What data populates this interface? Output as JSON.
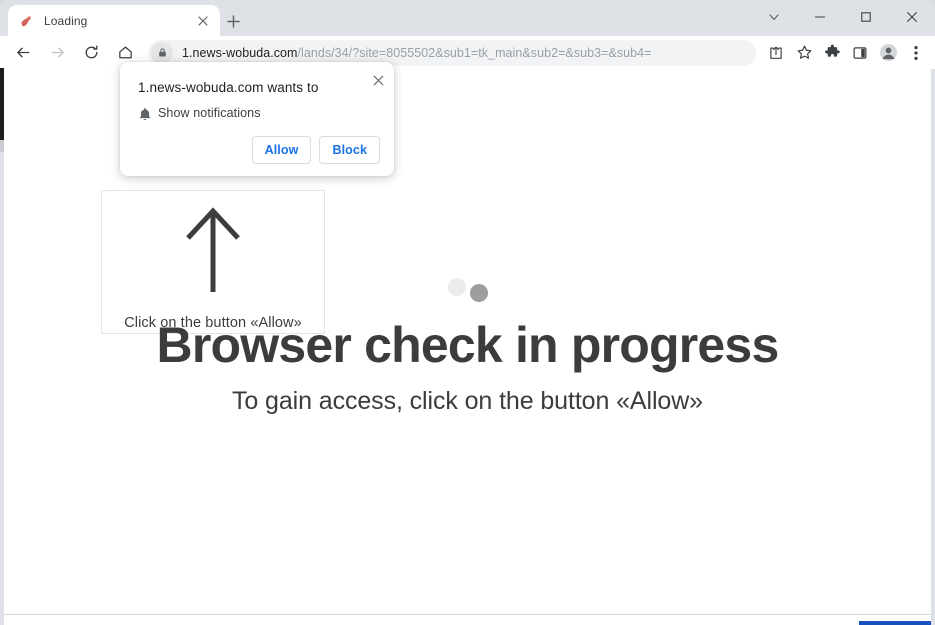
{
  "window": {
    "controls": {
      "tab_search": "tab-search-chevron",
      "minimize": "minimize",
      "maximize": "maximize",
      "close": "close"
    }
  },
  "tabstrip": {
    "tabs": [
      {
        "title": "Loading",
        "favicon": "site-favicon",
        "close_label": "Close tab"
      }
    ],
    "new_tab_label": "New tab"
  },
  "toolbar": {
    "back_label": "Back",
    "forward_label": "Forward",
    "reload_label": "Reload",
    "home_label": "Home",
    "omnibox": {
      "lock_icon": "lock-icon",
      "url_host": "1.news-wobuda.com",
      "url_path": "/lands/34/?site=8055502&sub1=tk_main&sub2=&sub3=&sub4=",
      "full_url": "1.news-wobuda.com/lands/34/?site=8055502&sub1=tk_main&sub2=&sub3=&sub4="
    },
    "actions": [
      {
        "name": "share-icon",
        "label": "Share this page"
      },
      {
        "name": "star-icon",
        "label": "Bookmark this tab"
      },
      {
        "name": "puzzle-icon",
        "label": "Extensions"
      },
      {
        "name": "side-panel-icon",
        "label": "Side panel"
      },
      {
        "name": "profile-avatar-icon",
        "label": "Profile"
      },
      {
        "name": "three-dot-menu-icon",
        "label": "Customize and control Google Chrome"
      }
    ]
  },
  "permission_bubble": {
    "title": "1.news-wobuda.com wants to",
    "request_icon": "bell-icon",
    "request_label": "Show notifications",
    "allow_label": "Allow",
    "block_label": "Block",
    "close_label": "Close",
    "accent_color": "#1a73e8"
  },
  "page": {
    "hint_box": {
      "arrow_icon": "up-arrow-icon",
      "text": "Click on the button «Allow»"
    },
    "loader": {
      "dot_one_color": "#ececec",
      "dot_two_color": "#9e9e9e"
    },
    "headline": "Browser check in progress",
    "subheadline": "To gain access, click on the button «Allow»",
    "footer_clipped_text": ""
  }
}
